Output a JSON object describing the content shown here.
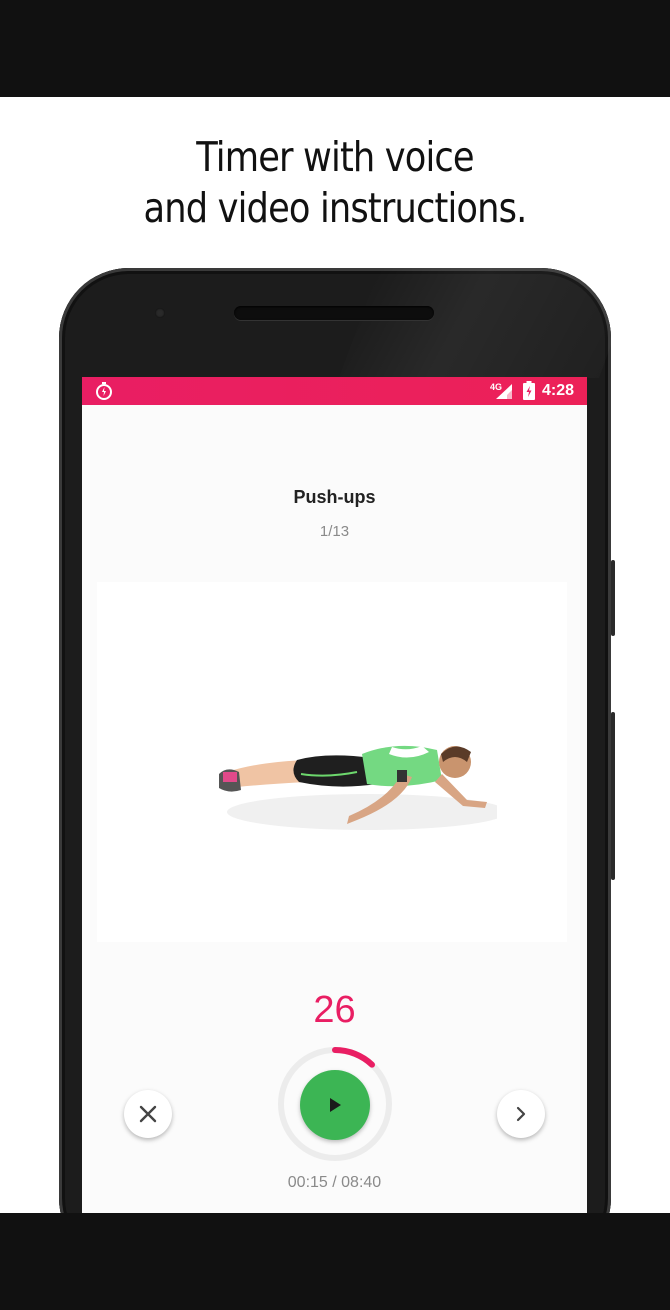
{
  "promo": {
    "line1": "Timer with voice",
    "line2": "and video instructions."
  },
  "status_bar": {
    "network": "4G",
    "time": "4:28",
    "color": "#e91e63"
  },
  "exercise": {
    "name": "Push-ups",
    "position": "1/13",
    "illustration": "push-up-figure"
  },
  "timer": {
    "seconds_left": "26",
    "progress_fraction": 0.12,
    "elapsed": "00:15 / 08:40",
    "accent": "#e91e63",
    "play_color": "#3cb554"
  },
  "controls": {
    "close_icon": "close-icon",
    "play_icon": "play-icon",
    "next_icon": "chevron-right-icon"
  }
}
